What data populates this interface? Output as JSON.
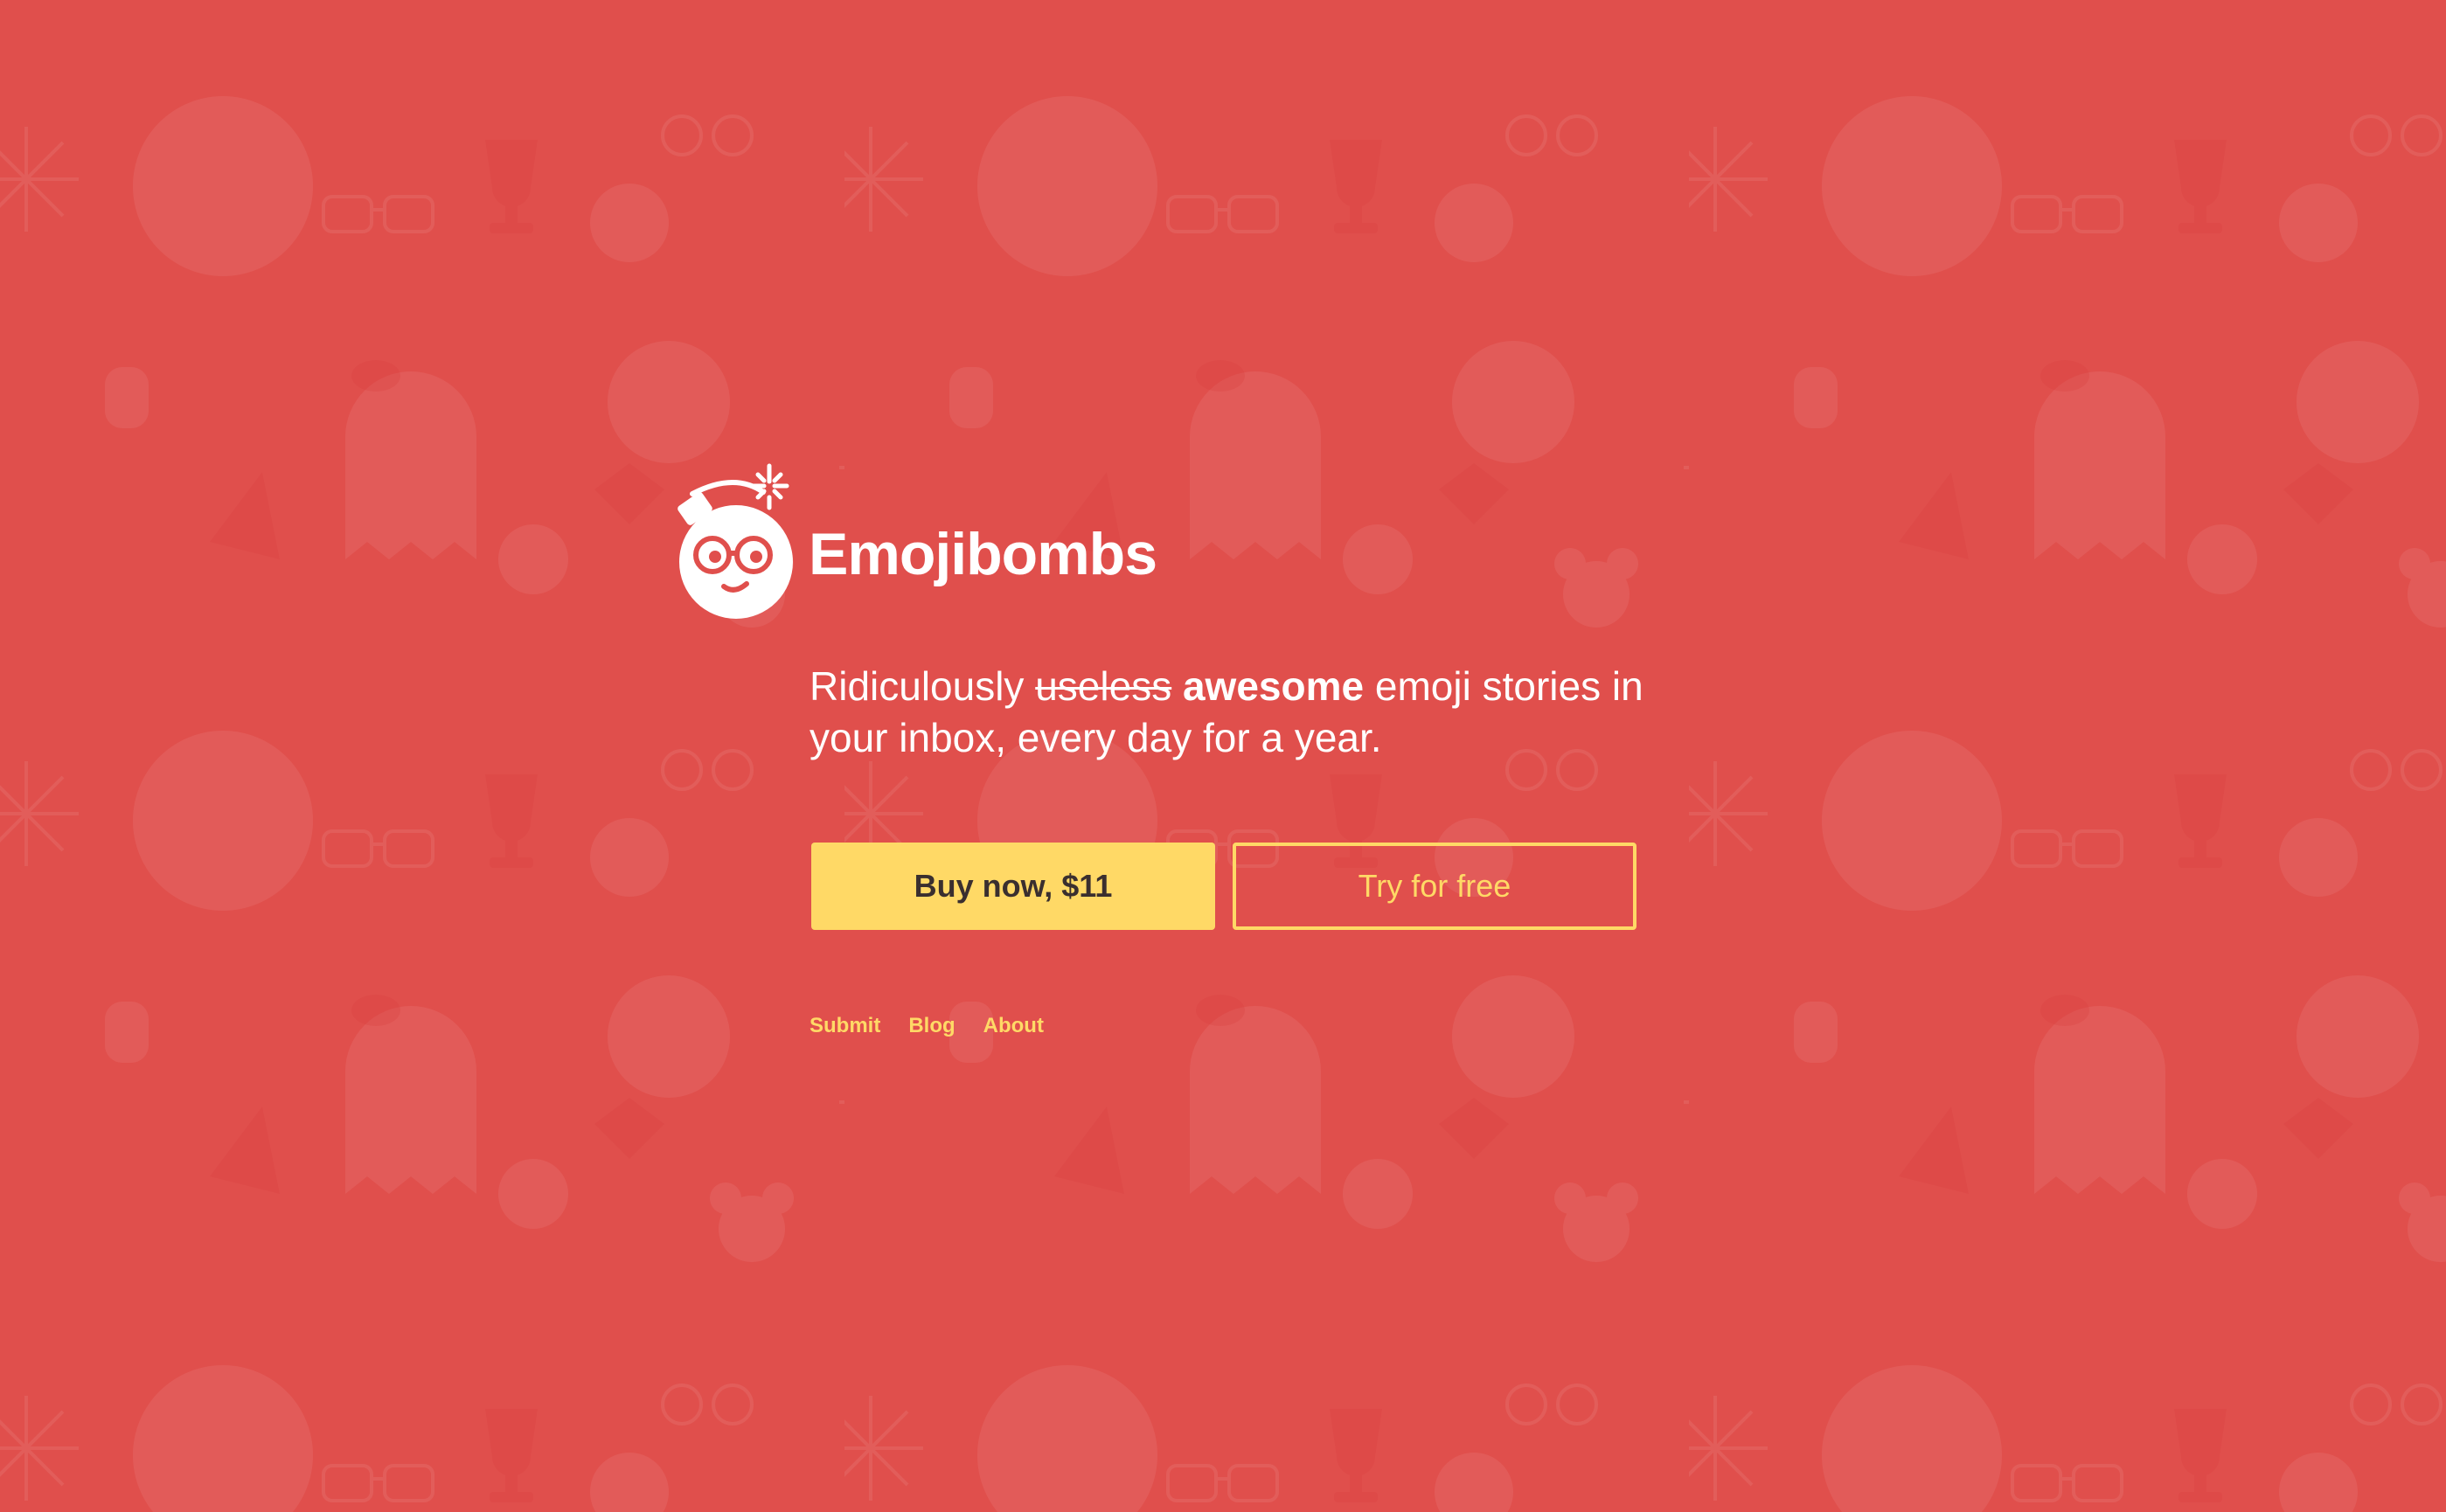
{
  "brand": {
    "name": "Emojibombs"
  },
  "tagline": {
    "prefix": "Ridiculously ",
    "struck": "useless",
    "strong": "awesome",
    "suffix": " emoji stories in your inbox, every day for a year."
  },
  "actions": {
    "buy_label": "Buy now, $11",
    "try_label": "Try for free"
  },
  "footer_nav": {
    "submit": "Submit",
    "blog": "Blog",
    "about": "About"
  },
  "colors": {
    "background": "#e04f4c",
    "accent": "#ffd966",
    "text": "#ffffff",
    "button_text": "#3a2f2f"
  }
}
